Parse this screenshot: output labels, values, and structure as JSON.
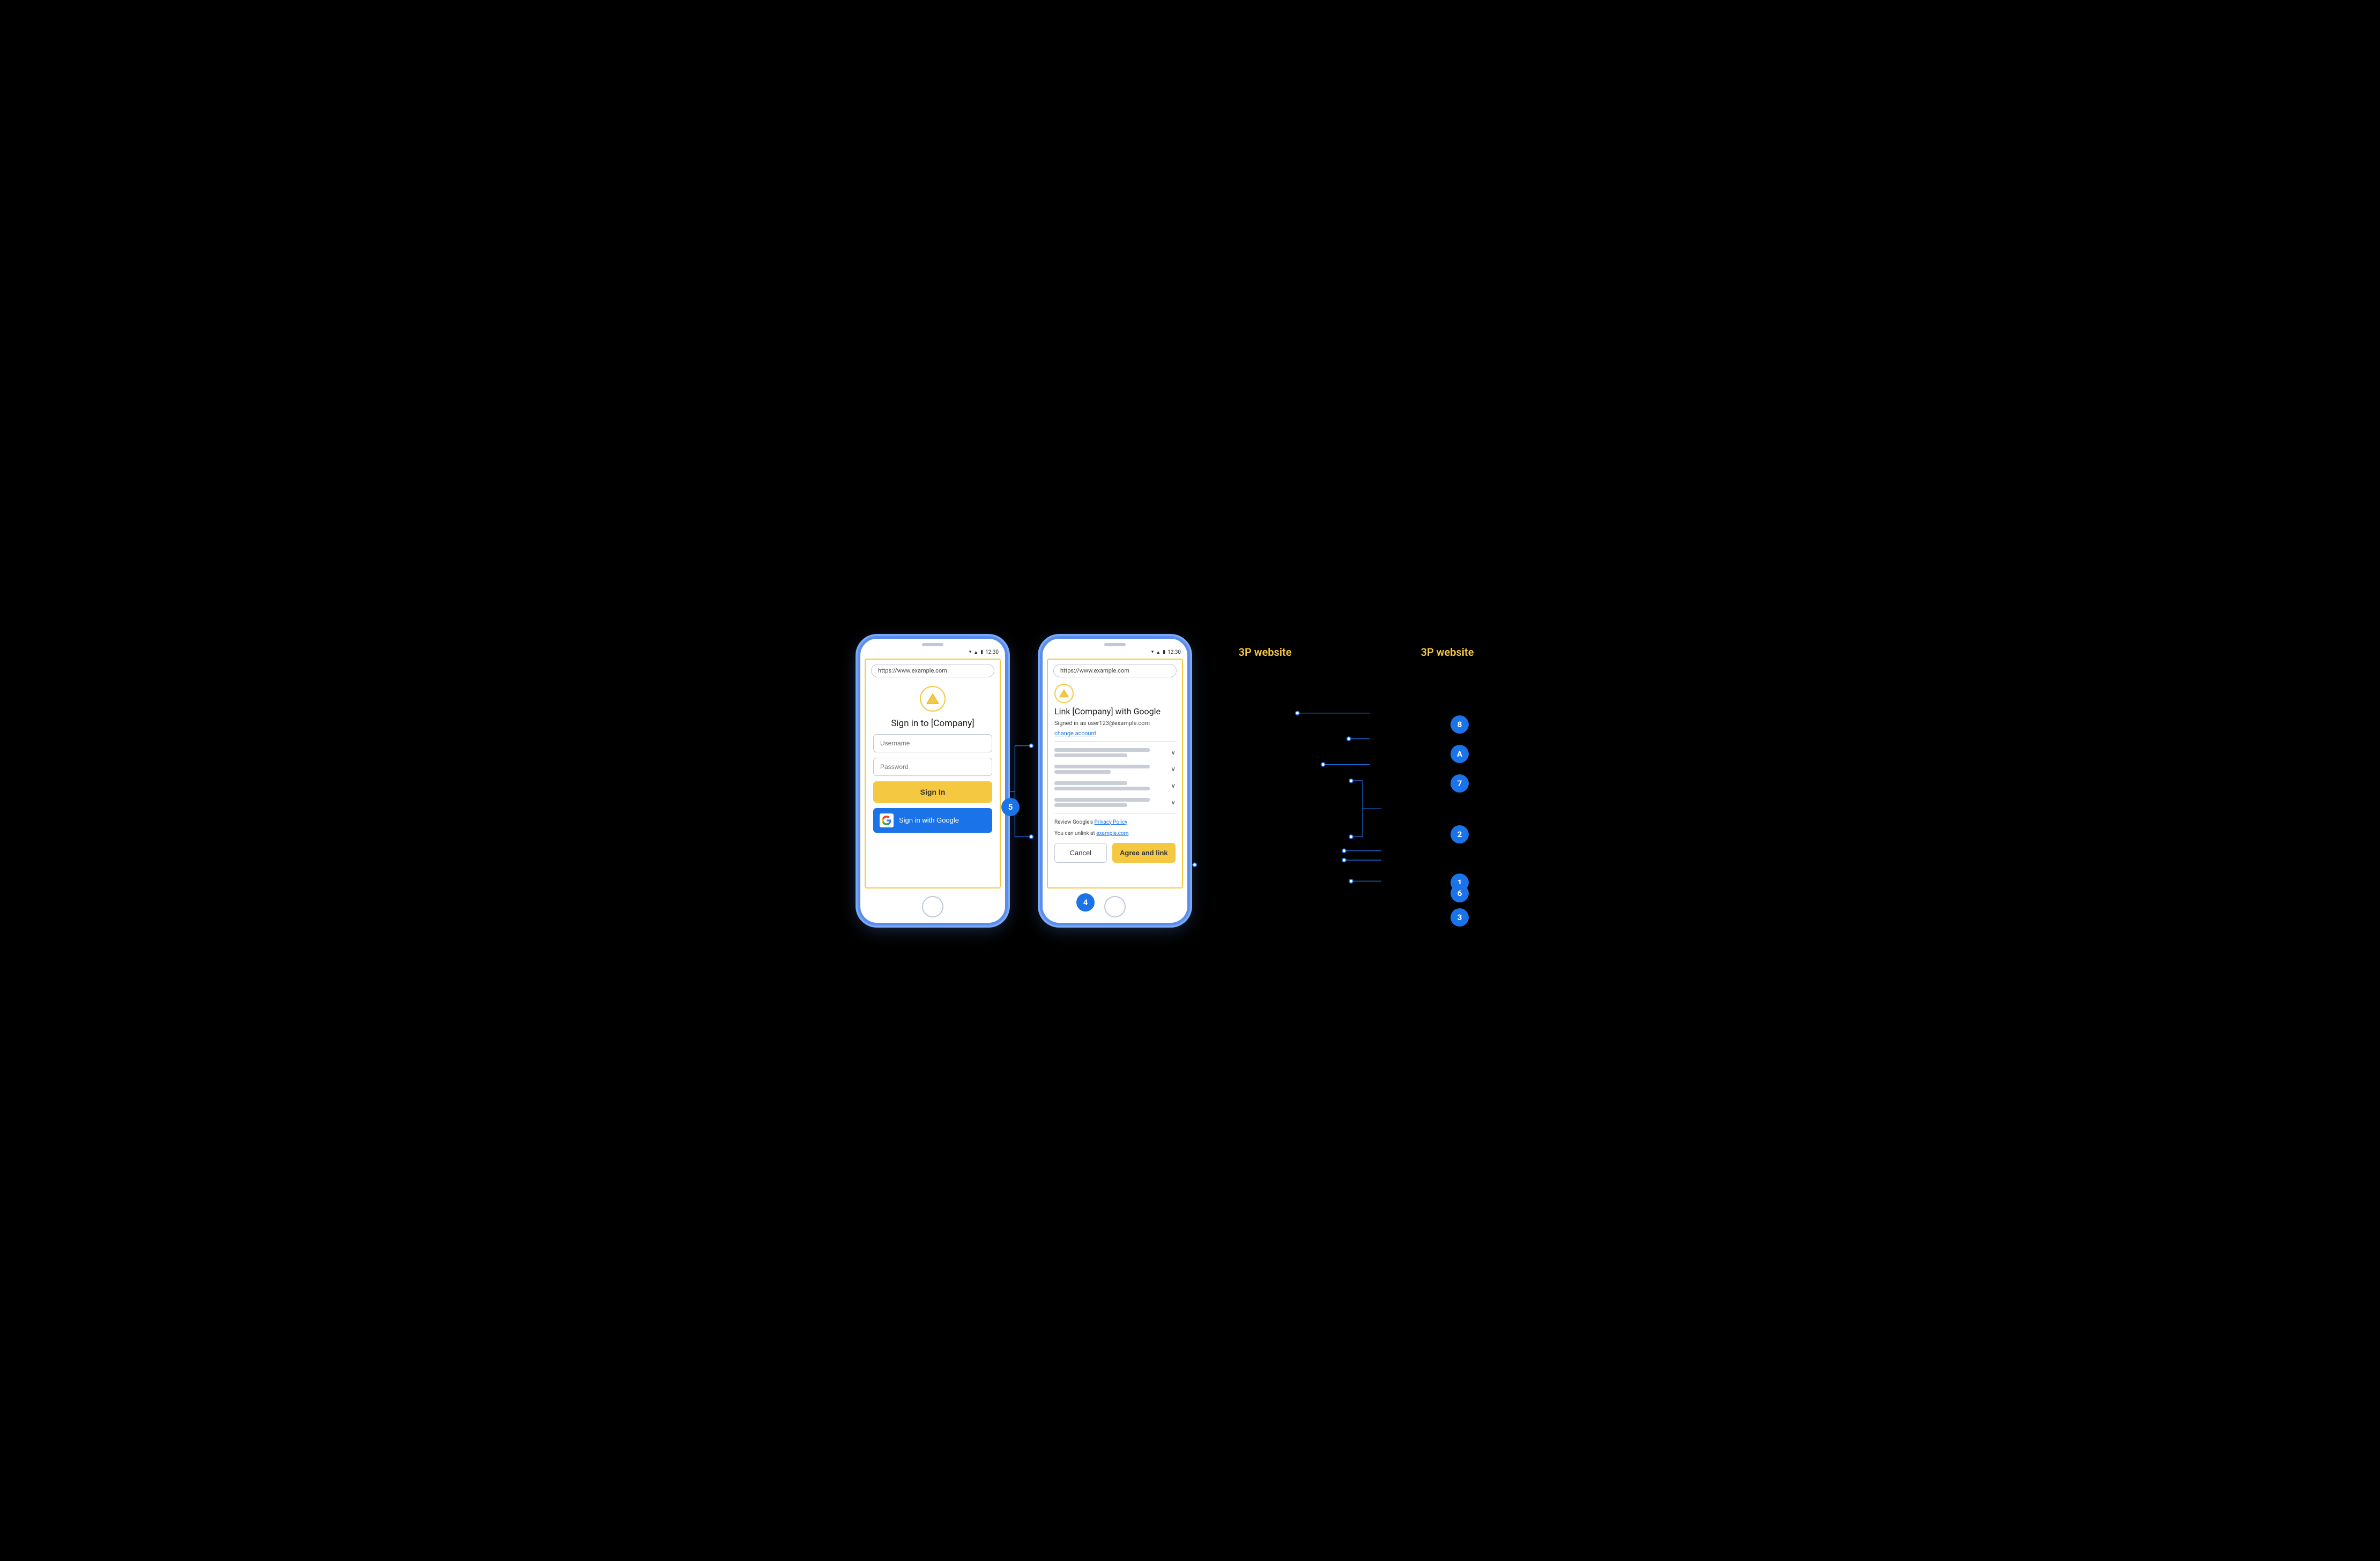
{
  "phone1": {
    "url": "https://www.example.com",
    "statusTime": "12:30",
    "logoAlt": "company-logo",
    "title": "Sign in to [Company]",
    "usernameLabel": "Username",
    "passwordLabel": "Password",
    "signInLabel": "Sign In",
    "googleSignInLabel": "Sign in with Google",
    "label": "3P website"
  },
  "phone2": {
    "url": "https://www.example.com",
    "statusTime": "12:30",
    "title": "Link [Company] with Google",
    "signedInAs": "Signed in as user123@example.com",
    "changeAccount": "change account",
    "privacyPolicyText": "Review Google's ",
    "privacyPolicyLink": "Privacy Policy",
    "unlinkText": "You can unlink at ",
    "unlinkLink": "example.com",
    "cancelLabel": "Cancel",
    "agreeLabel": "Agree and link",
    "label": "3P website"
  },
  "annotations": {
    "1": "1",
    "2": "2",
    "3": "3",
    "4": "4",
    "5": "5",
    "6": "6",
    "7": "7",
    "8": "8",
    "A": "A"
  }
}
